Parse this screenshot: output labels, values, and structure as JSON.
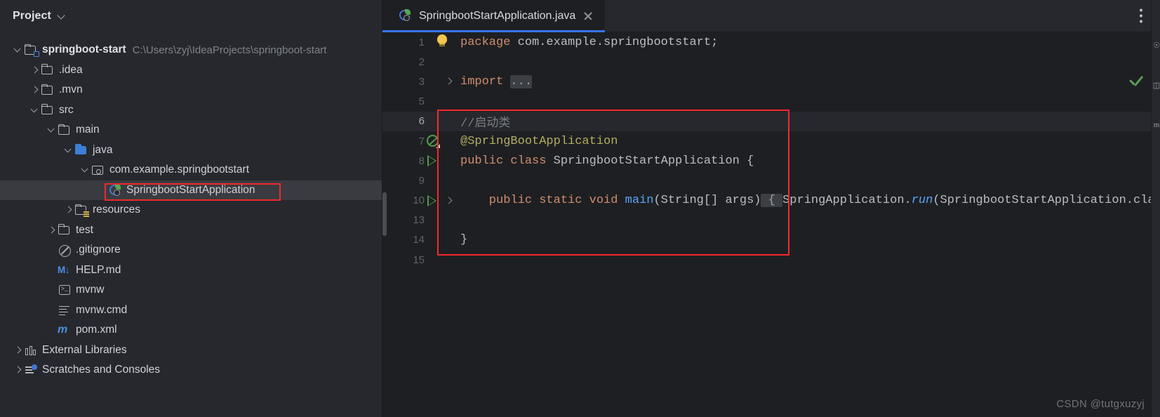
{
  "project_panel": {
    "title": "Project",
    "dropdown_icon": "chevron-down-icon",
    "tree": [
      {
        "label": "springboot-start",
        "hint": "C:\\Users\\zyj\\IdeaProjects\\springboot-start",
        "icon": "module-folder-icon",
        "arrow": "down",
        "indent": 0,
        "bold": true
      },
      {
        "label": ".idea",
        "hint": "",
        "icon": "folder-icon",
        "arrow": "right",
        "indent": 1,
        "bold": false
      },
      {
        "label": ".mvn",
        "hint": "",
        "icon": "folder-icon",
        "arrow": "right",
        "indent": 1,
        "bold": false
      },
      {
        "label": "src",
        "hint": "",
        "icon": "folder-icon",
        "arrow": "down",
        "indent": 1,
        "bold": false
      },
      {
        "label": "main",
        "hint": "",
        "icon": "folder-icon",
        "arrow": "down",
        "indent": 2,
        "bold": false
      },
      {
        "label": "java",
        "hint": "",
        "icon": "source-folder-icon",
        "arrow": "down",
        "indent": 3,
        "bold": false
      },
      {
        "label": "com.example.springbootstart",
        "hint": "",
        "icon": "package-icon",
        "arrow": "down",
        "indent": 4,
        "bold": false
      },
      {
        "label": "SpringbootStartApplication",
        "hint": "",
        "icon": "spring-boot-class-icon",
        "arrow": "none",
        "indent": 5,
        "bold": false,
        "selected": true,
        "highlighted": true
      },
      {
        "label": "resources",
        "hint": "",
        "icon": "resources-folder-icon",
        "arrow": "right",
        "indent": 3,
        "bold": false
      },
      {
        "label": "test",
        "hint": "",
        "icon": "folder-icon",
        "arrow": "right",
        "indent": 2,
        "bold": false
      },
      {
        "label": ".gitignore",
        "hint": "",
        "icon": "gitignore-icon",
        "arrow": "none",
        "indent": 2,
        "bold": false
      },
      {
        "label": "HELP.md",
        "hint": "",
        "icon": "markdown-icon",
        "arrow": "none",
        "indent": 2,
        "bold": false
      },
      {
        "label": "mvnw",
        "hint": "",
        "icon": "terminal-script-icon",
        "arrow": "none",
        "indent": 2,
        "bold": false
      },
      {
        "label": "mvnw.cmd",
        "hint": "",
        "icon": "cmd-script-icon",
        "arrow": "none",
        "indent": 2,
        "bold": false
      },
      {
        "label": "pom.xml",
        "hint": "",
        "icon": "maven-icon",
        "arrow": "none",
        "indent": 2,
        "bold": false
      },
      {
        "label": "External Libraries",
        "hint": "",
        "icon": "libraries-icon",
        "arrow": "right",
        "indent": 0,
        "bold": false
      },
      {
        "label": "Scratches and Consoles",
        "hint": "",
        "icon": "scratches-icon",
        "arrow": "right",
        "indent": 0,
        "bold": false
      }
    ]
  },
  "editor": {
    "tab": {
      "label": "SpringbootStartApplication.java",
      "icon": "spring-boot-class-icon",
      "close_icon": "close-icon",
      "active": true
    },
    "options_icon": "kebab-menu-icon",
    "inspection_status_icon": "check-mark-icon",
    "lines": [
      {
        "num": "1",
        "gutter": "none",
        "fold": false,
        "current": false,
        "tokens": [
          {
            "t": "package",
            "c": "t-kw"
          },
          {
            "t": " com.example.springbootstart;",
            "c": "t-id"
          }
        ]
      },
      {
        "num": "2",
        "gutter": "none",
        "fold": false,
        "current": false,
        "tokens": []
      },
      {
        "num": "3",
        "gutter": "none",
        "fold": true,
        "current": false,
        "tokens": [
          {
            "t": "import",
            "c": "t-kw"
          },
          {
            "t": " ",
            "c": "t-id"
          },
          {
            "t": "...",
            "c": "t-fold"
          }
        ]
      },
      {
        "num": "5",
        "gutter": "bulb",
        "fold": false,
        "current": false,
        "tokens": []
      },
      {
        "num": "6",
        "gutter": "none",
        "fold": false,
        "current": true,
        "tokens": [
          {
            "t": "//启动类",
            "c": "t-cmt"
          }
        ]
      },
      {
        "num": "7",
        "gutter": "bean",
        "fold": false,
        "current": false,
        "tokens": [
          {
            "t": "@SpringBootApplication",
            "c": "t-ann"
          }
        ]
      },
      {
        "num": "8",
        "gutter": "run",
        "fold": false,
        "current": false,
        "tokens": [
          {
            "t": "public class ",
            "c": "t-kw"
          },
          {
            "t": "SpringbootStartApplication ",
            "c": "t-cls"
          },
          {
            "t": "{",
            "c": "t-id"
          }
        ]
      },
      {
        "num": "9",
        "gutter": "none",
        "fold": false,
        "current": false,
        "tokens": []
      },
      {
        "num": "10",
        "gutter": "run",
        "fold": true,
        "current": false,
        "tokens": [
          {
            "t": "    public static void ",
            "c": "t-kw"
          },
          {
            "t": "main",
            "c": "t-meth"
          },
          {
            "t": "(String[] args)",
            "c": "t-id"
          },
          {
            "t": " { ",
            "c": "t-fold"
          },
          {
            "t": "SpringApplication.",
            "c": "t-id"
          },
          {
            "t": "run",
            "c": "t-methi"
          },
          {
            "t": "(SpringbootStartApplication.clas",
            "c": "t-id"
          }
        ]
      },
      {
        "num": "13",
        "gutter": "none",
        "fold": false,
        "current": false,
        "tokens": []
      },
      {
        "num": "14",
        "gutter": "none",
        "fold": false,
        "current": false,
        "tokens": [
          {
            "t": "}",
            "c": "t-id"
          }
        ]
      },
      {
        "num": "15",
        "gutter": "none",
        "fold": false,
        "current": false,
        "tokens": []
      }
    ]
  },
  "annotations": {
    "tree_highlight_color": "#f02a2a",
    "code_highlight_color": "#f8282c"
  },
  "right_toolwindow": {
    "icons": [
      "notifications-icon",
      "database-icon",
      "maven-icon"
    ]
  },
  "watermark": "CSDN @tutgxuzyj"
}
